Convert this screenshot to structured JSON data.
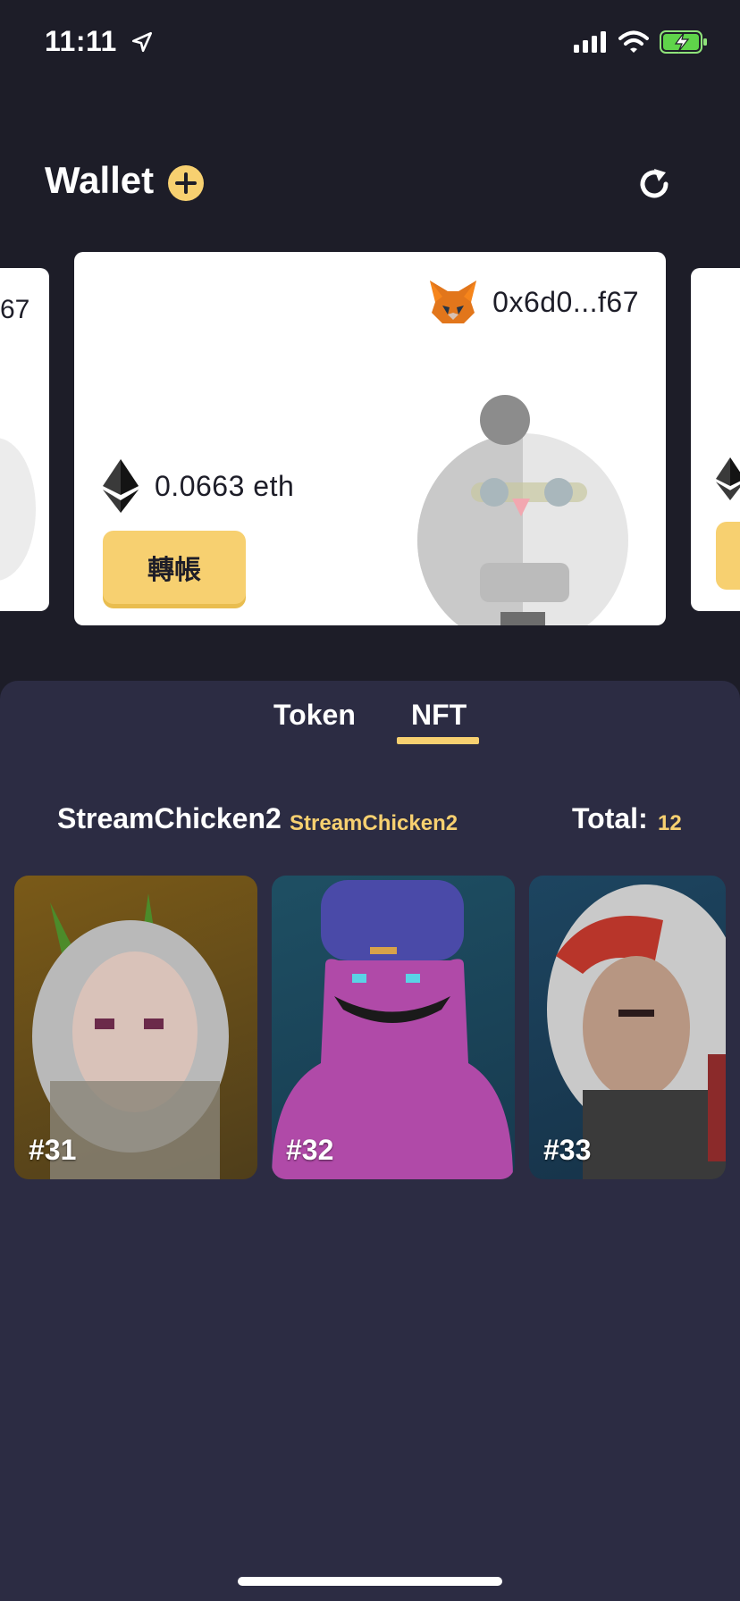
{
  "status_bar": {
    "time": "11:11"
  },
  "header": {
    "title": "Wallet"
  },
  "wallet_card": {
    "address": "0x6d0...f67",
    "balance": "0.0663 eth",
    "transfer_label": "轉帳"
  },
  "left_card": {
    "address_fragment": "67"
  },
  "tabs": [
    {
      "label": "Token",
      "active": false
    },
    {
      "label": "NFT",
      "active": true
    }
  ],
  "collection": {
    "name": "StreamChicken2",
    "subtitle": "StreamChicken2",
    "total_label": "Total:",
    "total_value": "12"
  },
  "nfts": [
    {
      "label": "#31"
    },
    {
      "label": "#32"
    },
    {
      "label": "#33"
    }
  ],
  "colors": {
    "accent": "#f7d070",
    "background": "#1d1d28",
    "panel": "#2c2c43"
  }
}
